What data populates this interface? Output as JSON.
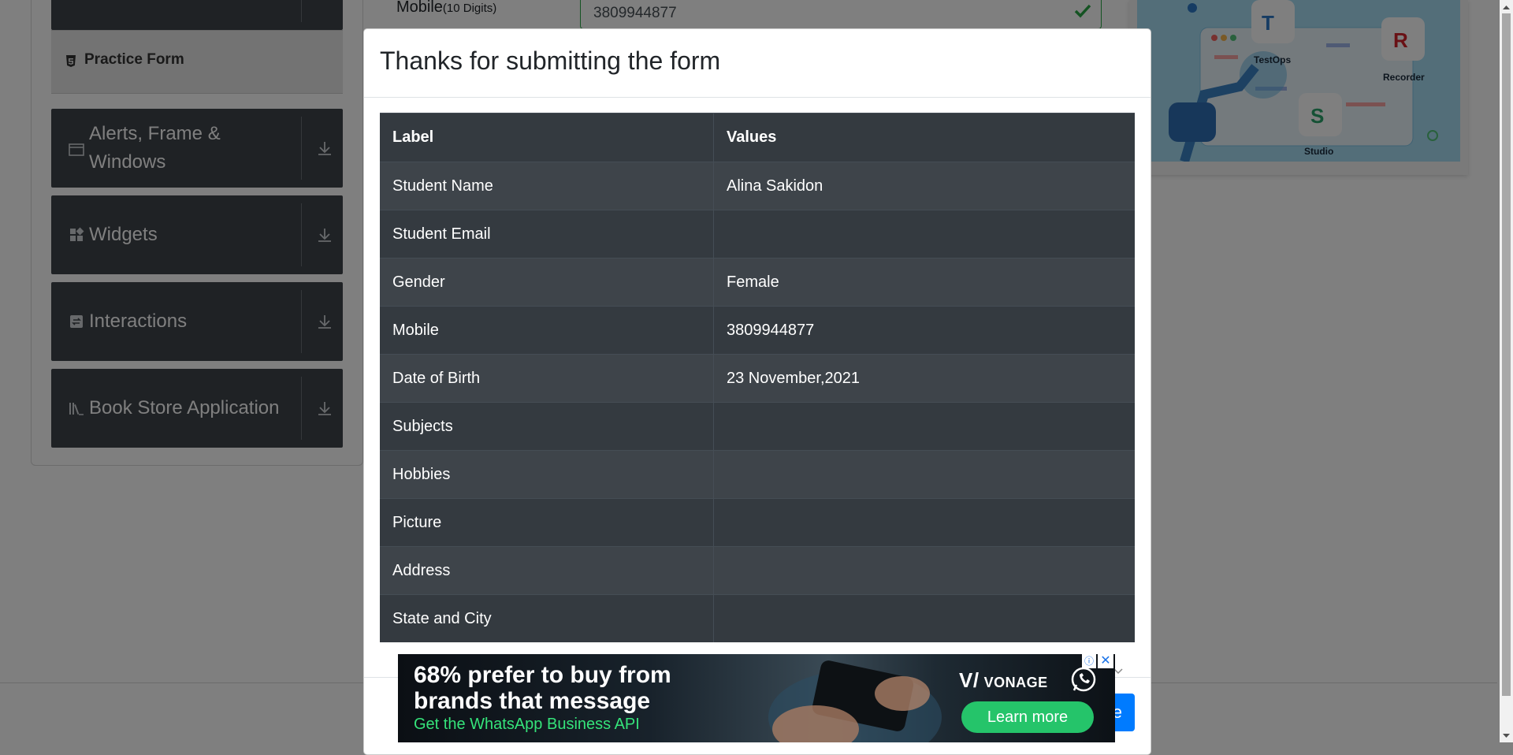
{
  "sidebar": {
    "active_item": "Practice Form",
    "groups": [
      {
        "label": "Alerts, Frame & Windows",
        "line1": "Alerts, Frame &",
        "line2": "Windows"
      },
      {
        "label": "Widgets"
      },
      {
        "label": "Interactions"
      },
      {
        "label": "Book Store Application"
      }
    ]
  },
  "form": {
    "mobile_label": "Mobile",
    "mobile_hint": "(10 Digits)",
    "mobile_value": "3809944877"
  },
  "banner": {
    "labels": [
      "TestOps",
      "Recorder",
      "Studio"
    ],
    "letters": [
      "T",
      "R",
      "S"
    ]
  },
  "modal": {
    "title": "Thanks for submitting the form",
    "headers": {
      "label": "Label",
      "values": "Values"
    },
    "rows": [
      {
        "label": "Student Name",
        "value": "Alina Sakidon"
      },
      {
        "label": "Student Email",
        "value": ""
      },
      {
        "label": "Gender",
        "value": "Female"
      },
      {
        "label": "Mobile",
        "value": "3809944877"
      },
      {
        "label": "Date of Birth",
        "value": "23 November,2021"
      },
      {
        "label": "Subjects",
        "value": ""
      },
      {
        "label": "Hobbies",
        "value": ""
      },
      {
        "label": "Picture",
        "value": ""
      },
      {
        "label": "Address",
        "value": ""
      },
      {
        "label": "State and City",
        "value": ""
      }
    ],
    "close_label": "e"
  },
  "ad": {
    "headline": "68% prefer to buy from brands that message",
    "subline": "Get the WhatsApp Business API",
    "brand": "VONAGE",
    "brand_mark": "V/",
    "cta": "Learn more",
    "info_icon": "info-icon",
    "close_icon": "close-icon"
  },
  "colors": {
    "overlay": "rgba(0,0,0,0.5)",
    "table_dark": "#343a40",
    "table_stripe": "#3e444a",
    "primary": "#007bff",
    "success": "#28a745",
    "ad_green": "#25c46a"
  }
}
